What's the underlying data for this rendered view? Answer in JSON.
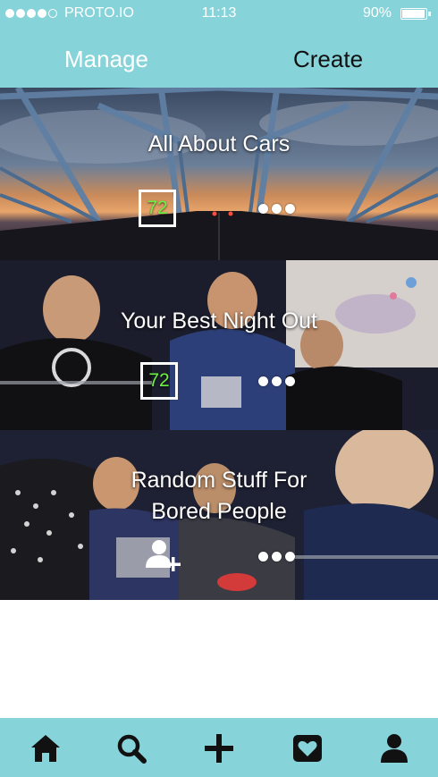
{
  "status_bar": {
    "carrier": "PROTO.IO",
    "time": "11:13",
    "battery": "90%",
    "battery_level": 0.9,
    "signal_bars": 4
  },
  "nav": {
    "manage_label": "Manage",
    "create_label": "Create"
  },
  "cards": [
    {
      "title": "All About Cars",
      "count": "72"
    },
    {
      "title": "Your Best Night Out",
      "count": "72"
    },
    {
      "title_line1": "Random Stuff For",
      "title_line2": "Bored People"
    }
  ],
  "tabbar": {
    "items": [
      "home-icon",
      "search-icon",
      "add-icon",
      "favorites-icon",
      "profile-icon"
    ]
  },
  "colors": {
    "accent": "#86d3d9",
    "count_text": "#6bf241"
  }
}
